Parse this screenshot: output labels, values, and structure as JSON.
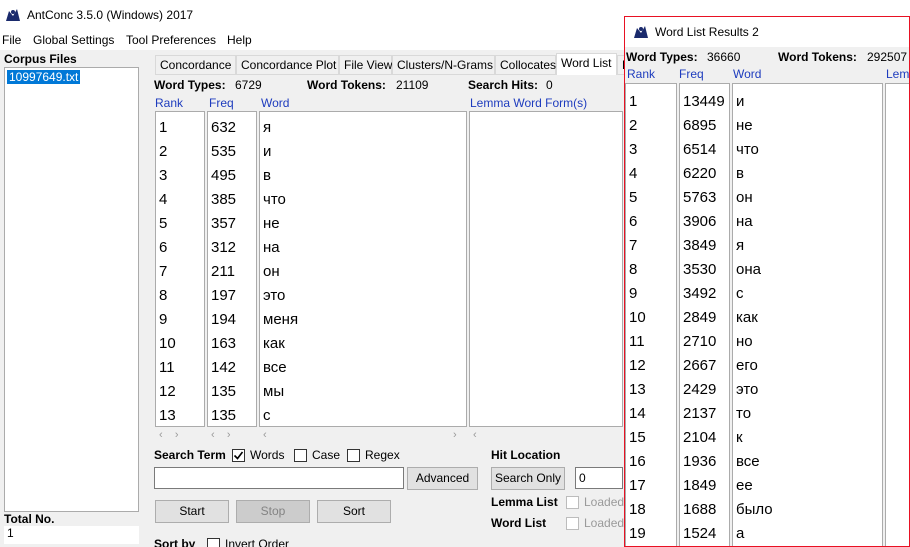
{
  "app": {
    "title": "AntConc 3.5.0 (Windows) 2017",
    "menu": [
      "File",
      "Global Settings",
      "Tool Preferences",
      "Help"
    ]
  },
  "corpus": {
    "header": "Corpus Files",
    "files": [
      "10997649.txt"
    ],
    "total_label": "Total No.",
    "total_value": "1"
  },
  "tabs": [
    "Concordance",
    "Concordance Plot",
    "File View",
    "Clusters/N-Grams",
    "Collocates",
    "Word List",
    "K"
  ],
  "wordlist": {
    "types_label": "Word Types:",
    "types_value": "6729",
    "tokens_label": "Word Tokens:",
    "tokens_value": "21109",
    "hits_label": "Search Hits:",
    "hits_value": "0",
    "col_rank": "Rank",
    "col_freq": "Freq",
    "col_word": "Word",
    "col_lemma": "Lemma Word Form(s)",
    "rows": [
      {
        "rank": "1",
        "freq": "632",
        "word": "я"
      },
      {
        "rank": "2",
        "freq": "535",
        "word": "и"
      },
      {
        "rank": "3",
        "freq": "495",
        "word": "в"
      },
      {
        "rank": "4",
        "freq": "385",
        "word": "что"
      },
      {
        "rank": "5",
        "freq": "357",
        "word": "не"
      },
      {
        "rank": "6",
        "freq": "312",
        "word": "на"
      },
      {
        "rank": "7",
        "freq": "211",
        "word": "он"
      },
      {
        "rank": "8",
        "freq": "197",
        "word": "это"
      },
      {
        "rank": "9",
        "freq": "194",
        "word": "меня"
      },
      {
        "rank": "10",
        "freq": "163",
        "word": "как"
      },
      {
        "rank": "11",
        "freq": "142",
        "word": "все"
      },
      {
        "rank": "12",
        "freq": "135",
        "word": "мы"
      },
      {
        "rank": "13",
        "freq": "135",
        "word": "с"
      }
    ]
  },
  "controls": {
    "search_term_label": "Search Term",
    "words_label": "Words",
    "case_label": "Case",
    "regex_label": "Regex",
    "advanced_label": "Advanced",
    "start_label": "Start",
    "stop_label": "Stop",
    "sort_label": "Sort",
    "hit_location_label": "Hit Location",
    "search_only_label": "Search Only",
    "hit_location_value": "0",
    "lemma_list_label": "Lemma List",
    "word_list_label": "Word List",
    "loaded_label": "Loaded",
    "sort_by_label": "Sort by",
    "invert_order_label": "Invert Order"
  },
  "results": {
    "title": "Word List Results 2",
    "types_label": "Word Types:",
    "types_value": "36660",
    "tokens_label": "Word Tokens:",
    "tokens_value": "292507",
    "col_rank": "Rank",
    "col_freq": "Freq",
    "col_word": "Word",
    "col_lemma": "Lemm",
    "rows": [
      {
        "rank": "1",
        "freq": "13449",
        "word": "и"
      },
      {
        "rank": "2",
        "freq": "6895",
        "word": "не"
      },
      {
        "rank": "3",
        "freq": "6514",
        "word": "что"
      },
      {
        "rank": "4",
        "freq": "6220",
        "word": "в"
      },
      {
        "rank": "5",
        "freq": "5763",
        "word": "он"
      },
      {
        "rank": "6",
        "freq": "3906",
        "word": "на"
      },
      {
        "rank": "7",
        "freq": "3849",
        "word": "я"
      },
      {
        "rank": "8",
        "freq": "3530",
        "word": "она"
      },
      {
        "rank": "9",
        "freq": "3492",
        "word": "с"
      },
      {
        "rank": "10",
        "freq": "2849",
        "word": "как"
      },
      {
        "rank": "11",
        "freq": "2710",
        "word": "но"
      },
      {
        "rank": "12",
        "freq": "2667",
        "word": "его"
      },
      {
        "rank": "13",
        "freq": "2429",
        "word": "это"
      },
      {
        "rank": "14",
        "freq": "2137",
        "word": "то"
      },
      {
        "rank": "15",
        "freq": "2104",
        "word": "к"
      },
      {
        "rank": "16",
        "freq": "1936",
        "word": "все"
      },
      {
        "rank": "17",
        "freq": "1849",
        "word": "ее"
      },
      {
        "rank": "18",
        "freq": "1688",
        "word": "было"
      },
      {
        "rank": "19",
        "freq": "1524",
        "word": "а"
      }
    ]
  }
}
